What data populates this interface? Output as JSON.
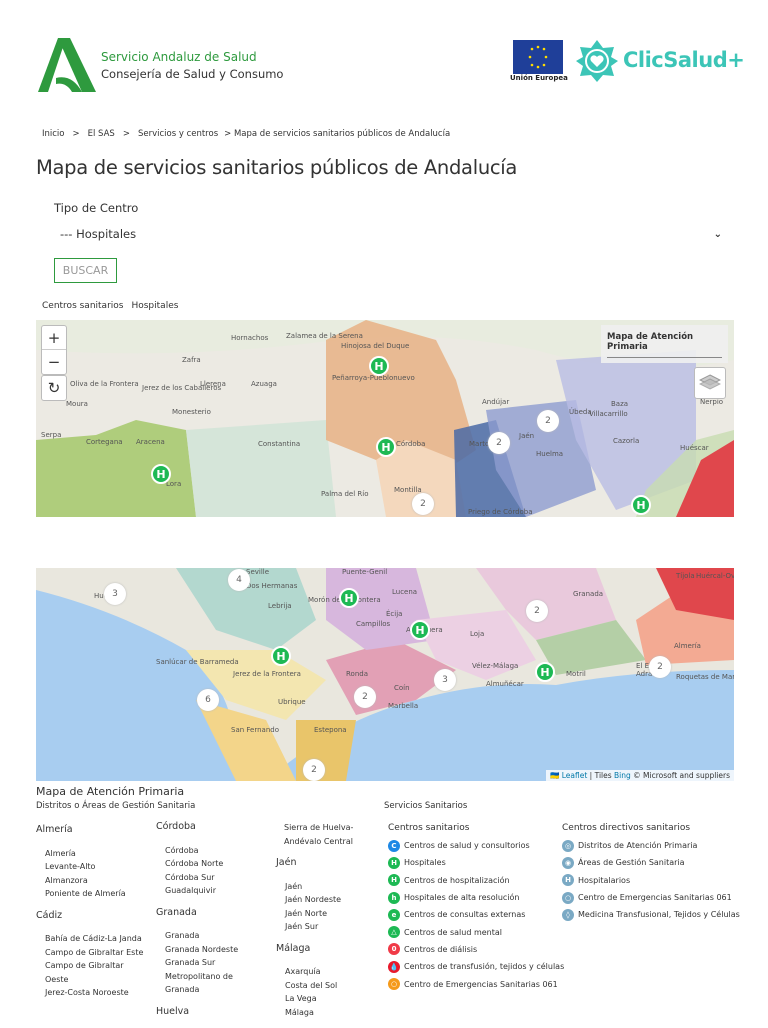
{
  "header": {
    "org_name": "Servicio Andaluz de Salud",
    "org_sub": "Consejería de Salud y Consumo",
    "eu_label": "Unión Europea",
    "clicsalud": "ClicSalud+"
  },
  "breadcrumb": [
    "Inicio",
    ">",
    "El SAS",
    ">",
    "Servicios y centros",
    "> Mapa de servicios sanitarios públicos de Andalucía"
  ],
  "page_title": "Mapa de servicios sanitarios públicos de Andalucía",
  "form": {
    "label": "Tipo de Centro",
    "selected": "--- Hospitales",
    "button": "BUSCAR"
  },
  "filter_tags": [
    "Centros sanitarios",
    "Hospitales"
  ],
  "map": {
    "zoom_in": "+",
    "zoom_out": "−",
    "overlay_title": "Mapa de Atención Primaria",
    "attribution": {
      "flag": "🇺🇦",
      "leaflet": "Leaflet",
      "sep": " | Tiles ",
      "bing": "Bing",
      "rest": " © Microsoft and suppliers"
    },
    "marker_label": "H",
    "clusters": [
      "2",
      "2",
      "2",
      "4",
      "3",
      "2",
      "3",
      "2",
      "6",
      "2",
      "2"
    ],
    "towns": [
      "Zalamea de la Serena",
      "Hornachos",
      "Hinojosa del Duque",
      "Peñarroya-Pueblonuevo",
      "Zafra",
      "Jerez de los Caballeros",
      "Oliva de la Frontera",
      "Moura",
      "Llerena",
      "Azuaga",
      "Serpa",
      "Monesterio",
      "Cortegana",
      "Aracena",
      "Constantina",
      "Córdoba",
      "Montilla",
      "Palma del Río",
      "Andújar",
      "Úbeda",
      "Jaén",
      "Martos",
      "Huelma",
      "Cazorla",
      "Baza",
      "Huéscar",
      "Villacarrillo",
      "Nerpio",
      "Seville",
      "Huelva",
      "Dos Hermanas",
      "Lebrija",
      "Morón de la Frontera",
      "Puente-Genil",
      "Lucena",
      "Antequera",
      "Loja",
      "Granada",
      "Motril",
      "Almuñécar",
      "Vélez-Málaga",
      "Marbella",
      "Estepona",
      "Ronda",
      "Jerez de la Frontera",
      "San Fernando",
      "Sanlúcar de Barrameda",
      "Ubrique",
      "Adra",
      "El Ejido",
      "Almería",
      "Roquetas de Mar",
      "Tíjola",
      "Huércal-Overa",
      "Coín",
      "Campillos",
      "Écija",
      "Priego de Córdoba",
      "Lora"
    ]
  },
  "legend": {
    "title": "Mapa de Atención Primaria",
    "subtitle": "Distritos o Áreas de Gestión Sanitaria",
    "provinces": [
      {
        "name": "Almería",
        "items": [
          "Almería",
          "Levante-Alto",
          "Almanzora",
          "Poniente de Almería"
        ]
      },
      {
        "name": "Cádiz",
        "items": [
          "Bahía de Cádiz-La Janda",
          "Campo de Gibraltar Este",
          "Campo de Gibraltar Oeste",
          "Jerez-Costa Noroeste"
        ]
      },
      {
        "name": "Córdoba",
        "items": [
          "Córdoba",
          "Córdoba Norte",
          "Córdoba Sur",
          "Guadalquivir"
        ]
      },
      {
        "name": "Granada",
        "items": [
          "Granada",
          "Granada Nordeste",
          "Granada Sur",
          "Metropolitano de Granada"
        ]
      },
      {
        "name": "Huelva",
        "items": [
          "Sierra de Huelva-Andévalo Central"
        ]
      },
      {
        "name": "Jaén",
        "items": [
          "Jaén",
          "Jaén Nordeste",
          "Jaén Norte",
          "Jaén Sur"
        ]
      },
      {
        "name": "Málaga",
        "items": [
          "Axarquía",
          "Costa del Sol",
          "La Vega",
          "Málaga"
        ]
      }
    ],
    "services_title": "Servicios Sanitarios",
    "centros": {
      "title": "Centros sanitarios",
      "items": [
        {
          "label": "Centros de salud y consultorios",
          "glyph": "C",
          "color": "#1e88e5"
        },
        {
          "label": "Hospitales",
          "glyph": "H",
          "color": "#1db954"
        },
        {
          "label": "Centros de hospitalización",
          "glyph": "H",
          "color": "#1db954"
        },
        {
          "label": "Hospitales de alta resolución",
          "glyph": "h",
          "color": "#1db954"
        },
        {
          "label": "Centros de consultas externas",
          "glyph": "e",
          "color": "#1db954"
        },
        {
          "label": "Centros de salud mental",
          "glyph": "△",
          "color": "#1db954"
        },
        {
          "label": "Centros de diálisis",
          "glyph": "0",
          "color": "#f03a47"
        },
        {
          "label": "Centros de transfusión, tejidos y células",
          "glyph": "💧",
          "color": "#e8192c"
        },
        {
          "label": "Centro de Emergencias Sanitarias 061",
          "glyph": "○",
          "color": "#f59a1b"
        }
      ]
    },
    "directivos": {
      "title": "Centros directivos sanitarios",
      "items": [
        {
          "label": "Distritos de Atención Primaria",
          "glyph": "◎",
          "color": "#7aa9c4"
        },
        {
          "label": "Áreas de Gestión Sanitaria",
          "glyph": "◉",
          "color": "#7aa9c4"
        },
        {
          "label": "Hospitalarios",
          "glyph": "H",
          "color": "#7aa9c4"
        },
        {
          "label": "Centro de Emergencias Sanitarias 061",
          "glyph": "○",
          "color": "#7aa9c4"
        },
        {
          "label": "Medicina Transfusional, Tejidos y Células",
          "glyph": "◊",
          "color": "#7aa9c4"
        }
      ]
    }
  }
}
